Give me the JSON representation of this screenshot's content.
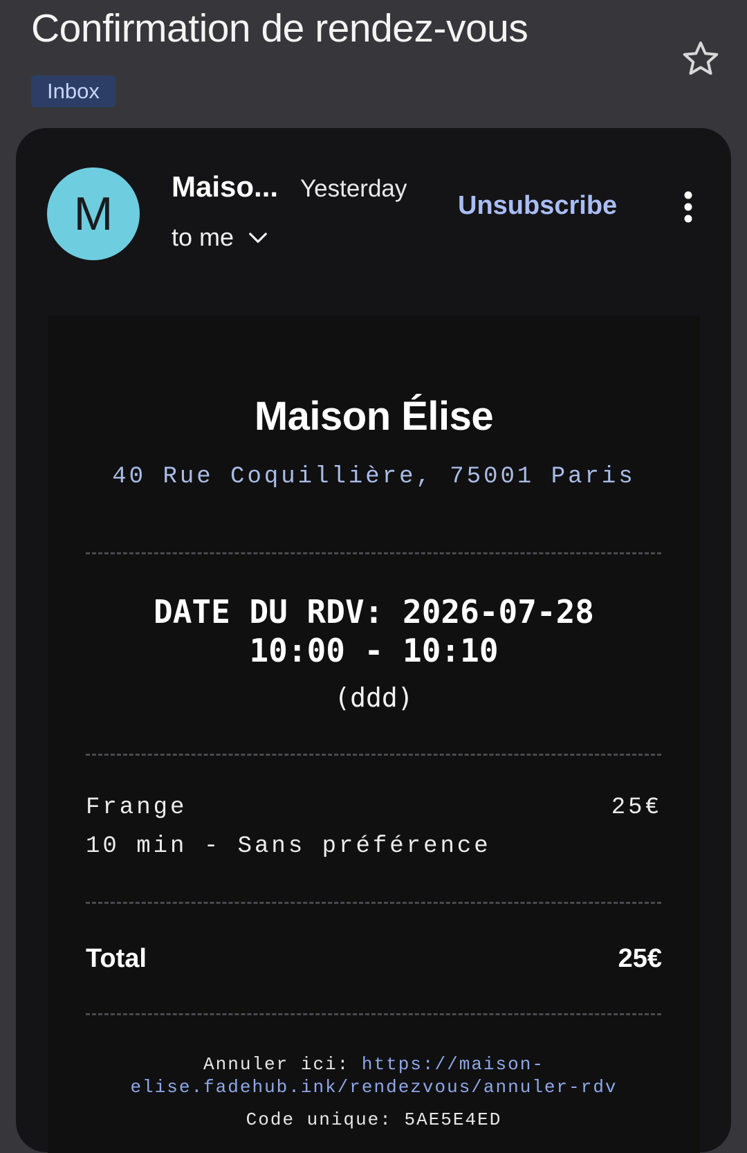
{
  "email": {
    "subject": "Confirmation de rendez-vous",
    "label": "Inbox",
    "sender_short": "Maiso...",
    "sender_initial": "M",
    "time": "Yesterday",
    "recipient": "to me",
    "unsubscribe_label": "Unsubscribe"
  },
  "receipt": {
    "shop_name": "Maison Élise",
    "address": "40 Rue Coquillière, 75001 Paris",
    "date_line": "DATE DU RDV: 2026-07-28",
    "time_line": "10:00 - 10:10",
    "day_placeholder": "(ddd)",
    "service_name": "Frange",
    "service_price": "25€",
    "service_detail": "10 min - Sans préférence",
    "total_label": "Total",
    "total_value": "25€",
    "cancel_label": "Annuler ici:",
    "cancel_url": "https://maison-elise.fadehub.ink/rendezvous/annuler-rdv",
    "code_label": "Code unique:",
    "code_value": "5AE5E4ED"
  },
  "colors": {
    "background": "#37373b",
    "card": "#141416",
    "avatar": "#6fcde0",
    "label_bg": "#2c3e66",
    "link": "#a9bdf5"
  },
  "icons": [
    "star-icon",
    "chevron-down-icon",
    "more-vert-icon"
  ]
}
